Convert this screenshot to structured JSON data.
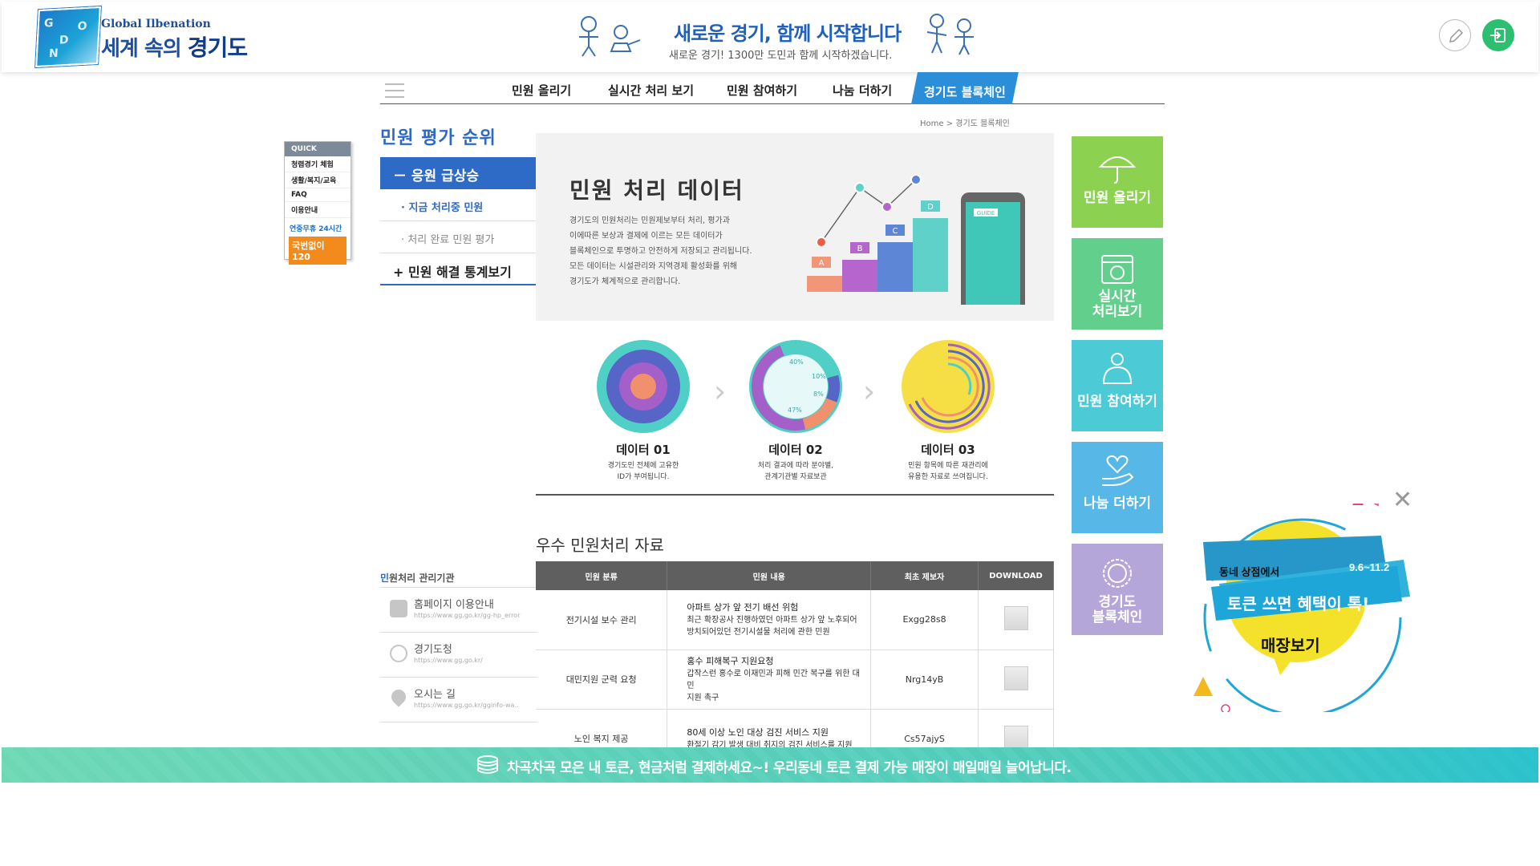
{
  "header": {
    "logo_sub": "Global Ilbenation",
    "logo_main_prefix": "세계 속의 ",
    "logo_main_bold": "경기도",
    "banner_title": "새로운 경기, 함께 시작합니다",
    "banner_sub": "새로운 경기! 1300만 도민과 함께 시작하겠습니다.",
    "edit_icon": "pencil-icon",
    "login_icon": "login-icon",
    "login_color": "#2bbf6f"
  },
  "nav": {
    "items": [
      "민원 올리기",
      "실시간 처리 보기",
      "민원 참여하기",
      "나눔 더하기"
    ],
    "active": "경기도 블록체인",
    "active_color": "#2a8fd8"
  },
  "breadcrumb": {
    "home": "Home",
    "sep": ">",
    "current": "경기도 블록체인"
  },
  "quick": {
    "head": "QUICK",
    "items": [
      "청렴경기 체험",
      "생활/복지/교육",
      "FAQ",
      "이용안내"
    ],
    "blue": "연중무휴 24시간",
    "call": "국번없이 120"
  },
  "sidebar": {
    "title": "민원 평가 순위",
    "active": "－ 응원 급상승",
    "subs": [
      "· 지금 처리중 민원",
      "· 처리 완료 민원 평가"
    ],
    "plus": "+ 민원 해결 통계보기",
    "accent": "#2e6bc6"
  },
  "orgs": {
    "title_mark": "민",
    "title_rest": "원처리 관리기관",
    "items": [
      {
        "name": "홈페이지 이용안내",
        "url": "https://www.gg.go.kr/gg-hp_error"
      },
      {
        "name": "경기도청",
        "url": "https://www.gg.go.kr/"
      },
      {
        "name": "오시는 길",
        "url": "https://www.gg.go.kr/gginfo-wa.."
      }
    ]
  },
  "hero": {
    "title": "민원 처리 데이터",
    "desc_lines": [
      "경기도의 민원처리는 민원제보부터 처리, 평가과",
      "이에따른 보상과 결제에 이르는 모든  데이터가",
      "블록체인으로 투명하고 안전하게 저장되고 관리됩니다.",
      "모든 데이터는 시설관리와 지역경제 활성화를 위해",
      "경기도가 체계적으로 관리합니다."
    ],
    "bar_labels": [
      "A",
      "B",
      "C",
      "D"
    ],
    "phone_label": "GUIDE"
  },
  "steps": [
    {
      "title": "데이터 01",
      "desc": [
        "경기도민 전체에 고유한",
        "ID가 부여됩니다."
      ]
    },
    {
      "title": "데이터 02",
      "desc": [
        "처리 결과에 따라 분야별,",
        "관계기관별 자료보관"
      ],
      "ring_labels": [
        "40%",
        "10%",
        "8%",
        "47%"
      ]
    },
    {
      "title": "데이터 03",
      "desc": [
        "민원 항목에 따른 재관리에",
        "유용한 자료로 쓰여집니다."
      ]
    }
  ],
  "section": {
    "title": "우수 민원처리 자료"
  },
  "table": {
    "headers": [
      "민원 분류",
      "민원 내용",
      "최초 제보자",
      "DOWNLOAD"
    ],
    "rows": [
      {
        "category": "전기시설 보수 관리",
        "title": "아파트 상가 앞 전기 배선 위험",
        "desc1": "최근 확장공사 진행하였던 아파트 상가 앞 노후되어",
        "desc2": "방치되어있던 전기시설물 처리에 관한 민원",
        "reporter": "Exgg28s8"
      },
      {
        "category": "대민지원 군력 요청",
        "title": "홍수 피해복구 지원요청",
        "desc1": "갑작스런 홍수로 이재민과 피해 민간 복구를 위한 대민",
        "desc2": "지원 촉구",
        "reporter": "Nrg14yB"
      },
      {
        "category": "노인 복지 제공",
        "title": "80세 이상 노인 대상 검진 서비스 지원",
        "desc1": "환절기 감기 발생 대비 취지의 검진 서비스를 지원",
        "desc2": "",
        "reporter": "Cs57ajyS"
      }
    ]
  },
  "tiles": [
    {
      "label": [
        "민원 올리기"
      ],
      "icon": "umbrella-icon",
      "color": "#8cd250"
    },
    {
      "label": [
        "실시간",
        "처리보기"
      ],
      "icon": "calendar-icon",
      "color": "#63cf8c"
    },
    {
      "label": [
        "민원 참여하기"
      ],
      "icon": "piggy-bank-icon",
      "color": "#4ccad6"
    },
    {
      "label": [
        "나눔 더하기"
      ],
      "icon": "heart-hand-icon",
      "color": "#57b8e8"
    },
    {
      "label": [
        "경기도",
        "블록체인"
      ],
      "icon": "token-icon",
      "color": "#b5a6da"
    }
  ],
  "ad": {
    "top_left": "동네 상점에서",
    "date": "9.6~11.2",
    "ribbon": "토큰 쓰면 혜택이 톡!",
    "cta": "매장보기"
  },
  "bottom": {
    "text": "차곡차곡 모은 내 토큰, 현금처럼 결제하세요~! 우리동네 토큰 결제 가능 매장이 매일매일 늘어납니다.",
    "icon": "coin-stack-icon"
  }
}
